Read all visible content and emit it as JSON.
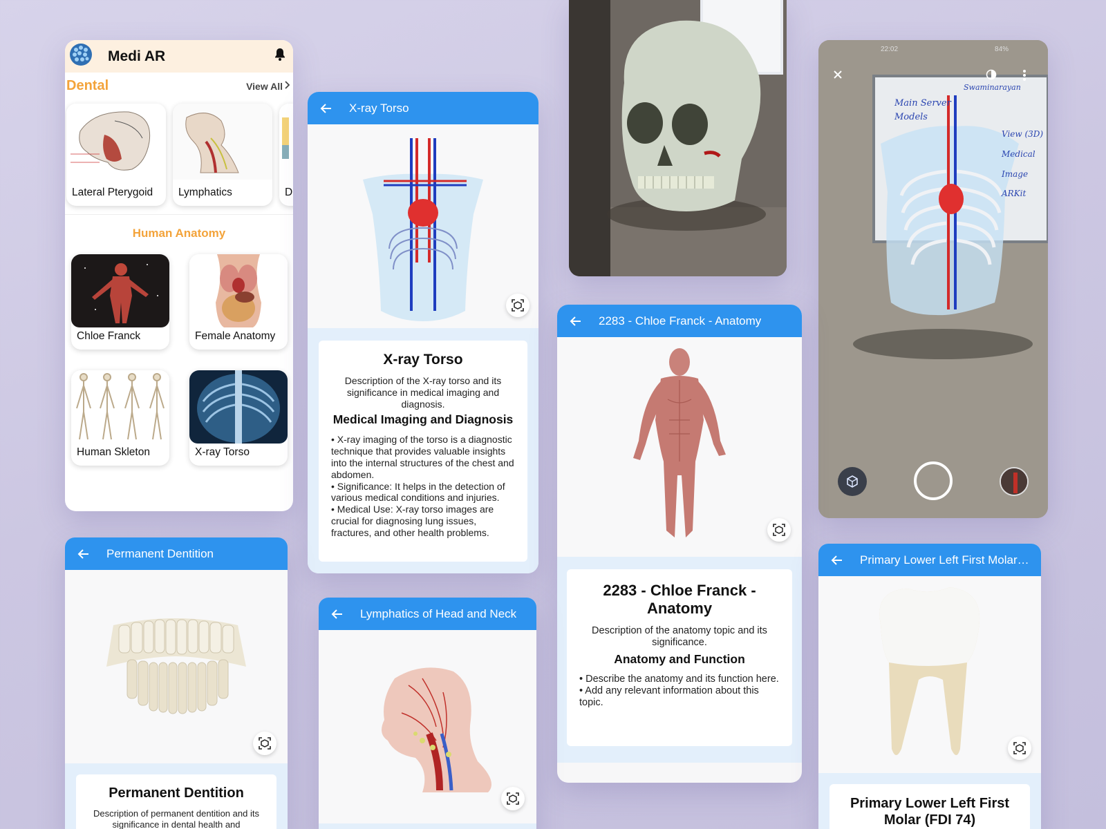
{
  "home": {
    "app_name": "Medi AR",
    "dental_title": "Dental",
    "view_all": "View All",
    "dental_items": [
      "Lateral Pterygoid",
      "Lymphatics",
      "D"
    ],
    "human_title": "Human Anatomy",
    "human_items": [
      "Chloe Franck",
      "Female Anatomy",
      "Human Skleton",
      "X-ray Torso"
    ]
  },
  "xray": {
    "appbar_title": "X-ray Torso",
    "title": "X-ray Torso",
    "description": "Description of the X-ray torso and its significance in medical imaging and diagnosis.",
    "subtitle": "Medical Imaging and Diagnosis",
    "bullets": [
      "• X-ray imaging of the torso is a diagnostic technique that provides valuable insights into the internal structures of the chest and abdomen.",
      "• Significance: It helps in the detection of various medical conditions and injuries.",
      "• Medical Use: X-ray torso images are crucial for diagnosing lung issues, fractures, and other health problems."
    ]
  },
  "chloe": {
    "appbar_title": "2283 - Chloe Franck - Anatomy",
    "title": "2283 - Chloe Franck - Anatomy",
    "description": "Description of the anatomy topic and its significance.",
    "subtitle": "Anatomy and Function",
    "bullets": [
      "• Describe the anatomy and its function here.",
      "• Add any relevant information about this topic."
    ]
  },
  "dentition": {
    "appbar_title": "Permanent Dentition",
    "title": "Permanent Dentition",
    "description": "Description of permanent dentition and its significance in dental health and"
  },
  "lymph": {
    "appbar_title": "Lymphatics of Head and Neck"
  },
  "molar": {
    "appbar_title": "Primary Lower Left First Molar ...",
    "title": "Primary Lower Left First Molar (FDI 74)"
  },
  "camera": {
    "status_time": "22:02",
    "status_battery": "84%",
    "board_lines": [
      "Main Server",
      "Models",
      "View (3D)",
      "Medical Image",
      "ARKit",
      "Swaminarayan"
    ]
  },
  "colors": {
    "appbar_blue": "#2e93ee",
    "accent_orange": "#f3a33a",
    "header_cream": "#fdf0e0",
    "info_bg": "#e3effb"
  },
  "icons": [
    "brain-logo-icon",
    "bell-icon",
    "chevron-right-icon",
    "back-arrow-icon",
    "ar-view-icon",
    "close-icon",
    "contrast-icon",
    "more-vert-icon",
    "cube-icon",
    "shutter-icon"
  ]
}
